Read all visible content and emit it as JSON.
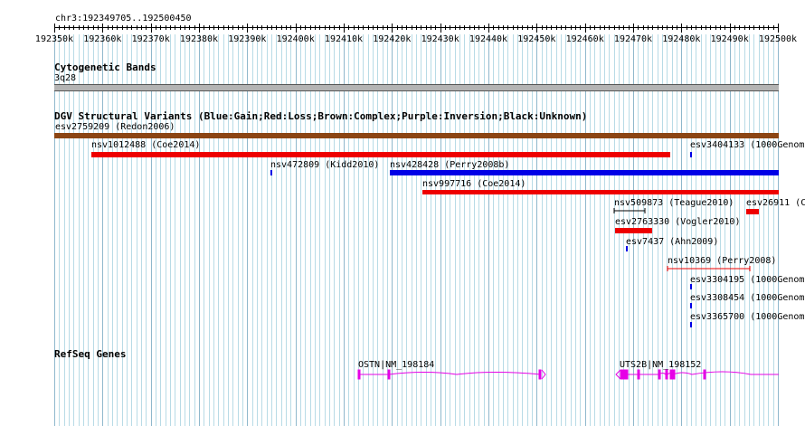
{
  "ruler": {
    "location": "chr3:192349705..192500450",
    "ticks": [
      "192350k",
      "192360k",
      "192370k",
      "192380k",
      "192390k",
      "192400k",
      "192410k",
      "192420k",
      "192430k",
      "192440k",
      "192450k",
      "192460k",
      "192470k",
      "192480k",
      "192490k",
      "192500k"
    ]
  },
  "cyto": {
    "title": "Cytogenetic Bands",
    "band": "3q28"
  },
  "dgv": {
    "title": "DGV Structural Variants (Blue:Gain;Red:Loss;Brown:Complex;Purple:Inversion;Black:Unknown)",
    "colors": {
      "gain": "#0000e6",
      "loss": "#ee0000",
      "complex": "#8b4513",
      "unknown": "#000000"
    },
    "features": [
      {
        "label": "esv2759209 (Redon2006)",
        "type": "complex"
      },
      {
        "label": "nsv1012488 (Coe2014)",
        "type": "loss"
      },
      {
        "label": "esv3404133 (1000Genome",
        "type": "gain"
      },
      {
        "label": "nsv472809 (Kidd2010)",
        "type": "gain"
      },
      {
        "label": "nsv428428 (Perry2008b)",
        "type": "gain"
      },
      {
        "label": "nsv997716 (Coe2014)",
        "type": "loss"
      },
      {
        "label": "nsv509873 (Teague2010)",
        "type": "unknown"
      },
      {
        "label": "esv26911 (C",
        "type": "loss"
      },
      {
        "label": "esv2763330 (Vogler2010)",
        "type": "loss"
      },
      {
        "label": "esv7437 (Ahn2009)",
        "type": "gain"
      },
      {
        "label": "nsv10369 (Perry2008)",
        "type": "loss"
      },
      {
        "label": "esv3304195 (1000Genome",
        "type": "gain"
      },
      {
        "label": "esv3308454 (1000Genome",
        "type": "gain"
      },
      {
        "label": "esv3365700 (1000Genome",
        "type": "gain"
      }
    ]
  },
  "refseq": {
    "title": "RefSeq Genes",
    "color": "#e600e6",
    "genes": [
      {
        "label": "OSTN|NM_198184",
        "strand": "+"
      },
      {
        "label": "UTS2B|NM_198152",
        "strand": "-"
      }
    ]
  }
}
